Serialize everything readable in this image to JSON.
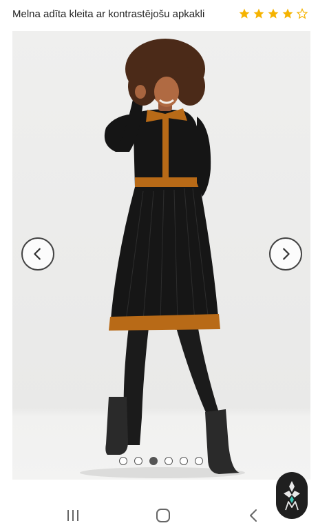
{
  "product": {
    "title": "Melna adīta kleita ar kontrastējošu apkakli",
    "rating": 4,
    "rating_max": 5,
    "star_color": "#f5b301"
  },
  "gallery": {
    "image_icon": "dress-photo",
    "prev_icon": "chevron-left-icon",
    "next_icon": "chevron-right-icon",
    "dot_count": 6,
    "active_index": 3
  },
  "system_nav": {
    "recent_icon": "recent-apps-icon",
    "home_icon": "home-icon",
    "back_icon": "back-icon"
  },
  "fab": {
    "icon": "brand-logo-icon",
    "background": "#1f1f1f"
  }
}
